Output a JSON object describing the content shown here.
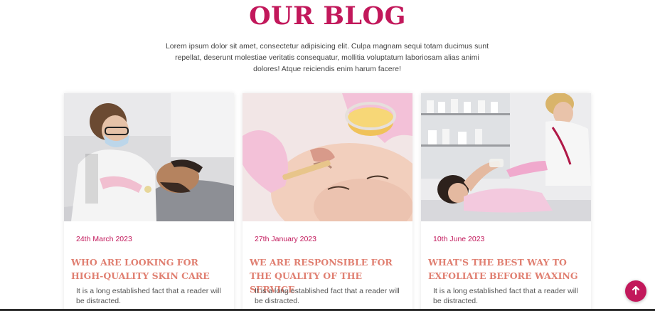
{
  "header": {
    "title": "OUR BLOG",
    "intro": "Lorem ipsum dolor sit amet, consectetur adipisicing elit. Culpa magnam sequi totam ducimus sunt repellat, deserunt molestiae veritatis consequatur, mollitia voluptatum laboriosam alias animi dolores! Atque reiciendis enim harum facere!"
  },
  "posts": [
    {
      "date": "24th March 2023",
      "title": "WHO ARE LOOKING FOR HIGH-QUALITY SKIN CARE",
      "excerpt": "It is a long established fact that a reader will be distracted."
    },
    {
      "date": "27th January 2023",
      "title": "WE ARE RESPONSIBLE FOR THE QUALITY OF THE SERVICE",
      "excerpt": "It is a long established fact that a reader will be distracted."
    },
    {
      "date": "10th June 2023",
      "title": "WHAT'S THE BEST WAY TO EXFOLIATE BEFORE WAXING",
      "excerpt": "It is a long established fact that a reader will be distracted."
    }
  ],
  "scroll_top": {
    "icon": "arrow-up-icon"
  },
  "colors": {
    "accent": "#c2185b",
    "post_title": "#e07f71",
    "text": "#444444"
  }
}
